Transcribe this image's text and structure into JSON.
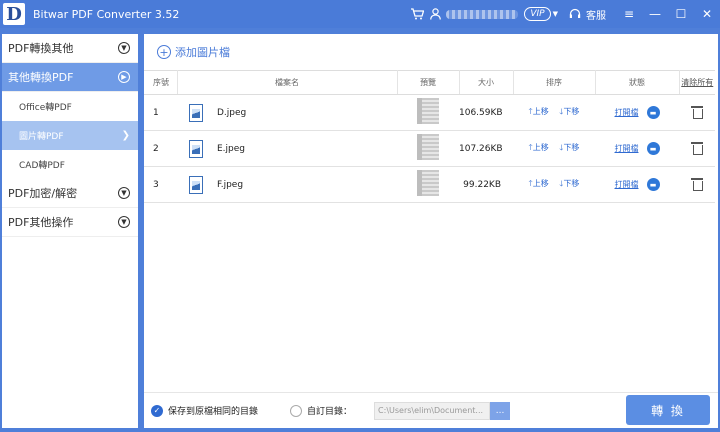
{
  "titlebar": {
    "logo_letter": "D",
    "title": "Bitwar PDF Converter 3.52",
    "vip": "VIP",
    "service_label": "客服",
    "icons": [
      "cart-icon",
      "user-icon",
      "headset-icon",
      "menu-icon",
      "minimize-icon",
      "maximize-icon",
      "close-icon"
    ]
  },
  "sidebar": {
    "cat1": "PDF轉換其他",
    "cat2": "其他轉換PDF",
    "sub1": "Office轉PDF",
    "sub2": "圖片轉PDF",
    "sub3": "CAD轉PDF",
    "cat3": "PDF加密/解密",
    "cat4": "PDF其他操作"
  },
  "main": {
    "add_label": "添加圖片檔",
    "headers": {
      "index": "序號",
      "filename": "檔案名",
      "preview": "預覽",
      "size": "大小",
      "sort": "排序",
      "status": "狀態",
      "clear": "清除所有"
    },
    "rows": [
      {
        "index": "1",
        "name": "D.jpeg",
        "size": "106.59KB",
        "up": "上移",
        "down": "下移",
        "open": "打開檔"
      },
      {
        "index": "2",
        "name": "E.jpeg",
        "size": "107.26KB",
        "up": "上移",
        "down": "下移",
        "open": "打開檔"
      },
      {
        "index": "3",
        "name": "F.jpeg",
        "size": "99.22KB",
        "up": "上移",
        "down": "下移",
        "open": "打開檔"
      }
    ]
  },
  "bottom": {
    "opt_same": "保存到原檔相同的目錄",
    "opt_custom": "自訂目錄：",
    "path_placeholder": "C:\\Users\\elim\\Document...",
    "browse": "...",
    "convert": "轉 換"
  },
  "colors": {
    "accent": "#4a7bd8",
    "link": "#2f6ad1",
    "sidebar_active": "#6f9be6",
    "sidebar_sub_active": "#a6c3f0",
    "convert_btn": "#5b8ee3"
  }
}
